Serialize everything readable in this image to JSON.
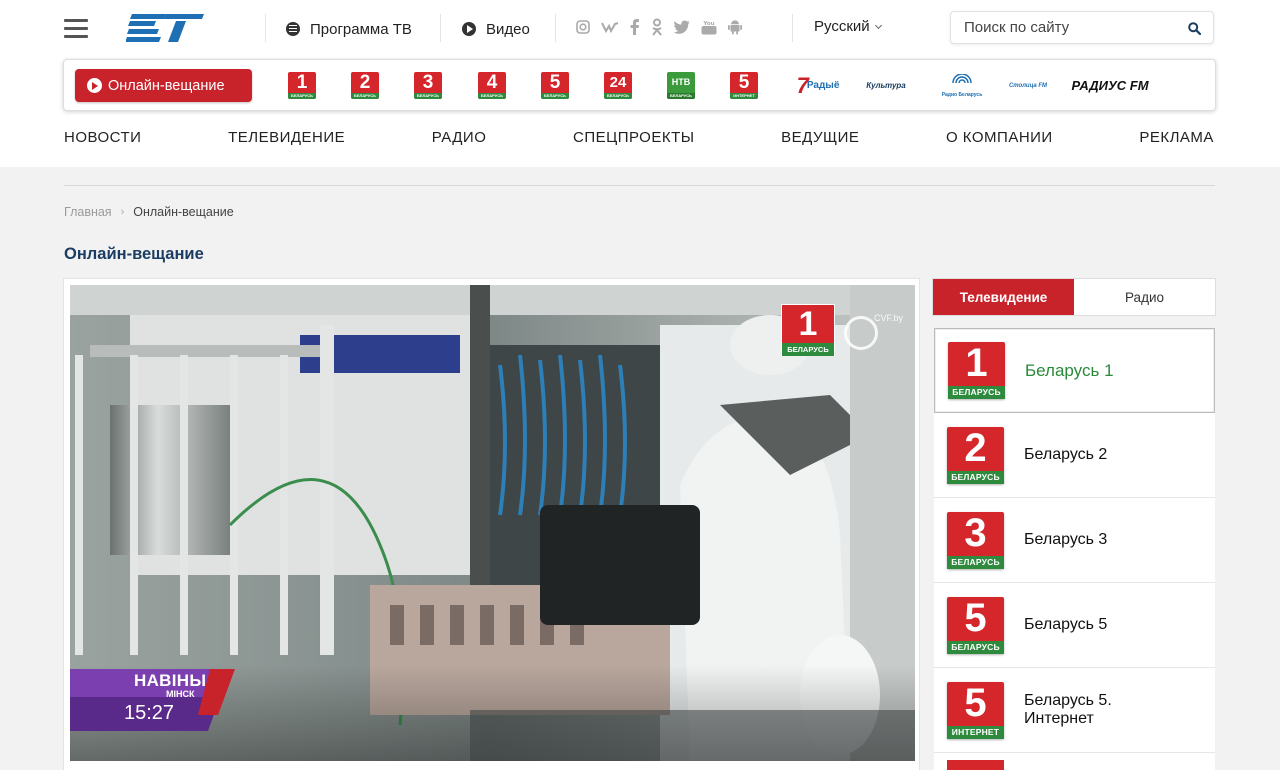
{
  "header": {
    "nav_links": {
      "program": "Программа ТВ",
      "video": "Видео"
    },
    "social_icons": [
      "instagram-icon",
      "vk-icon",
      "facebook-icon",
      "odnoklassniki-icon",
      "twitter-icon",
      "youtube-icon",
      "android-icon"
    ],
    "language": "Русский",
    "search": {
      "placeholder": "Поиск по сайту"
    }
  },
  "channel_bar": {
    "onair_label": "Онлайн-вещание",
    "tv_channels": [
      {
        "num": "1",
        "sub": "БЕЛАРУСЬ"
      },
      {
        "num": "2",
        "sub": "БЕЛАРУСЬ"
      },
      {
        "num": "3",
        "sub": "БЕЛАРУСЬ"
      },
      {
        "num": "4",
        "sub": "БЕЛАРУСЬ"
      },
      {
        "num": "5",
        "sub": "БЕЛАРУСЬ"
      },
      {
        "num": "24",
        "sub": "БЕЛАРУСЬ"
      },
      {
        "num": "НТВ",
        "sub": "БЕЛАРУСЬ"
      },
      {
        "num": "5",
        "sub": "ИНТЕРНЕТ"
      }
    ],
    "radio": [
      "Радыё",
      "Культура",
      "Радио Беларусь",
      "Столица FM",
      "РАДИУС FM"
    ]
  },
  "main_nav": [
    "НОВОСТИ",
    "ТЕЛЕВИДЕНИЕ",
    "РАДИО",
    "СПЕЦПРОЕКТЫ",
    "ВЕДУЩИЕ",
    "О КОМПАНИИ",
    "РЕКЛАМА"
  ],
  "breadcrumb": {
    "home": "Главная",
    "sep": "›",
    "current": "Онлайн-вещание"
  },
  "page_title": "Онлайн-вещание",
  "player": {
    "bug_num": "1",
    "bug_sub": "БЕЛАРУСЬ",
    "watermark": "CVF.by",
    "news_title": "НАВІНЫ",
    "news_city": "МІНСК",
    "clock": "15:27"
  },
  "tabs": {
    "tv": "Телевидение",
    "radio": "Радио"
  },
  "channel_list": [
    {
      "num": "1",
      "sub": "БЕЛАРУСЬ",
      "name": "Беларусь 1"
    },
    {
      "num": "2",
      "sub": "БЕЛАРУСЬ",
      "name": "Беларусь 2"
    },
    {
      "num": "3",
      "sub": "БЕЛАРУСЬ",
      "name": "Беларусь 3"
    },
    {
      "num": "5",
      "sub": "БЕЛАРУСЬ",
      "name": "Беларусь 5"
    },
    {
      "num": "5",
      "sub": "ИНТЕРНЕТ",
      "name": "Беларусь 5. Интернет"
    }
  ],
  "colors": {
    "brand_red": "#c8222b",
    "logo_blue": "#1e6fb3",
    "title_blue": "#1b3d63",
    "selected_green": "#2a8a3a"
  }
}
